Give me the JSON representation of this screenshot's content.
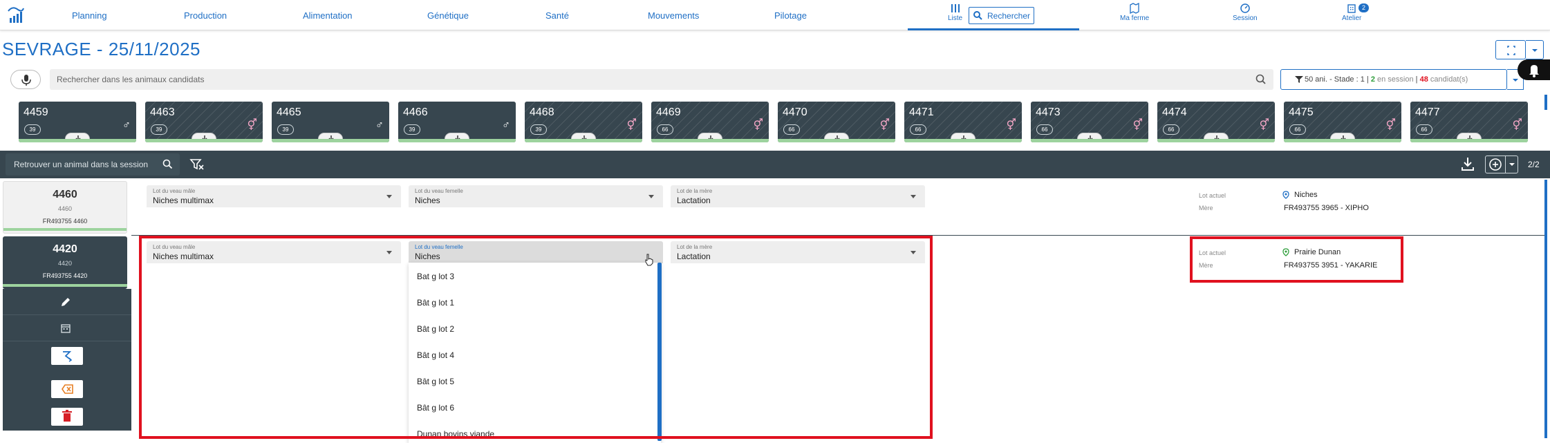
{
  "nav": {
    "items": [
      "Planning",
      "Production",
      "Alimentation",
      "Génétique",
      "Santé",
      "Mouvements",
      "Pilotage"
    ],
    "liste_label": "Liste",
    "search_label": "Rechercher",
    "ma_ferme_label": "Ma ferme",
    "session_label": "Session",
    "atelier_label": "Atelier",
    "atelier_badge": "2"
  },
  "page": {
    "title": "SEVRAGE - 25/11/2025"
  },
  "candidates": {
    "search_placeholder": "Rechercher dans les animaux candidats",
    "filter_summary": "50 ani. - Stade : 1 |",
    "filter_session_count": "2",
    "filter_session_label": "en session",
    "filter_sep": "|",
    "filter_candidate_count": "48",
    "filter_candidate_label": "candidat(s)"
  },
  "cards": [
    {
      "id": "4459",
      "stage": "39",
      "sex": "♂",
      "sex_color": "#ffffff",
      "hatched": false
    },
    {
      "id": "4463",
      "stage": "39",
      "sex": "⚥",
      "sex_color": "#f4a6c6",
      "hatched": true
    },
    {
      "id": "4465",
      "stage": "39",
      "sex": "♂",
      "sex_color": "#ffffff",
      "hatched": false
    },
    {
      "id": "4466",
      "stage": "39",
      "sex": "♂",
      "sex_color": "#ffffff",
      "hatched": false
    },
    {
      "id": "4468",
      "stage": "39",
      "sex": "⚥",
      "sex_color": "#f4a6c6",
      "hatched": true
    },
    {
      "id": "4469",
      "stage": "66",
      "sex": "⚥",
      "sex_color": "#f4a6c6",
      "hatched": true
    },
    {
      "id": "4470",
      "stage": "66",
      "sex": "⚥",
      "sex_color": "#f4a6c6",
      "hatched": true
    },
    {
      "id": "4471",
      "stage": "66",
      "sex": "⚥",
      "sex_color": "#f4a6c6",
      "hatched": true
    },
    {
      "id": "4473",
      "stage": "66",
      "sex": "⚥",
      "sex_color": "#f4a6c6",
      "hatched": true
    },
    {
      "id": "4474",
      "stage": "66",
      "sex": "⚥",
      "sex_color": "#f4a6c6",
      "hatched": true
    },
    {
      "id": "4475",
      "stage": "66",
      "sex": "⚥",
      "sex_color": "#f4a6c6",
      "hatched": true
    },
    {
      "id": "4477",
      "stage": "66",
      "sex": "⚥",
      "sex_color": "#f4a6c6",
      "hatched": true
    }
  ],
  "session_toolbar": {
    "search_placeholder": "Retrouver un animal dans la session",
    "pagination": "2/2"
  },
  "rows": [
    {
      "animal": "4460",
      "animal_sub": "4460",
      "animal_ref": "FR493755  4460",
      "fields": [
        {
          "label": "Lot du veau mâle",
          "value": "Niches multimax"
        },
        {
          "label": "Lot du veau femelle",
          "value": "Niches"
        },
        {
          "label": "Lot de la mère",
          "value": "Lactation"
        }
      ],
      "lot_actuel_label": "Lot actuel",
      "lot_actuel": "Niches",
      "mere_label": "Mère",
      "mere": "FR493755  3965 - XIPHO"
    },
    {
      "animal": "4420",
      "animal_sub": "4420",
      "animal_ref": "FR493755  4420",
      "fields": [
        {
          "label": "Lot du veau mâle",
          "value": "Niches multimax"
        },
        {
          "label": "Lot du veau femelle",
          "value": "Niches"
        },
        {
          "label": "Lot de la mère",
          "value": "Lactation"
        }
      ],
      "lot_actuel_label": "Lot actuel",
      "lot_actuel": "Prairie Dunan",
      "mere_label": "Mère",
      "mere": "FR493755  3951 - YAKARIE"
    }
  ],
  "dropdown_options": [
    "Bat g lot 3",
    "Bât g lot 1",
    "Bât g lot 2",
    "Bât g lot 4",
    "Bât g lot 5",
    "Bât g lot 6",
    "Dunan bovins viande"
  ],
  "colors": {
    "accent": "#1f6fc5",
    "dark": "#37464f",
    "highlight_red": "#e0111f",
    "green_bar": "#9dd39e",
    "female_pink": "#f4a6c6"
  }
}
